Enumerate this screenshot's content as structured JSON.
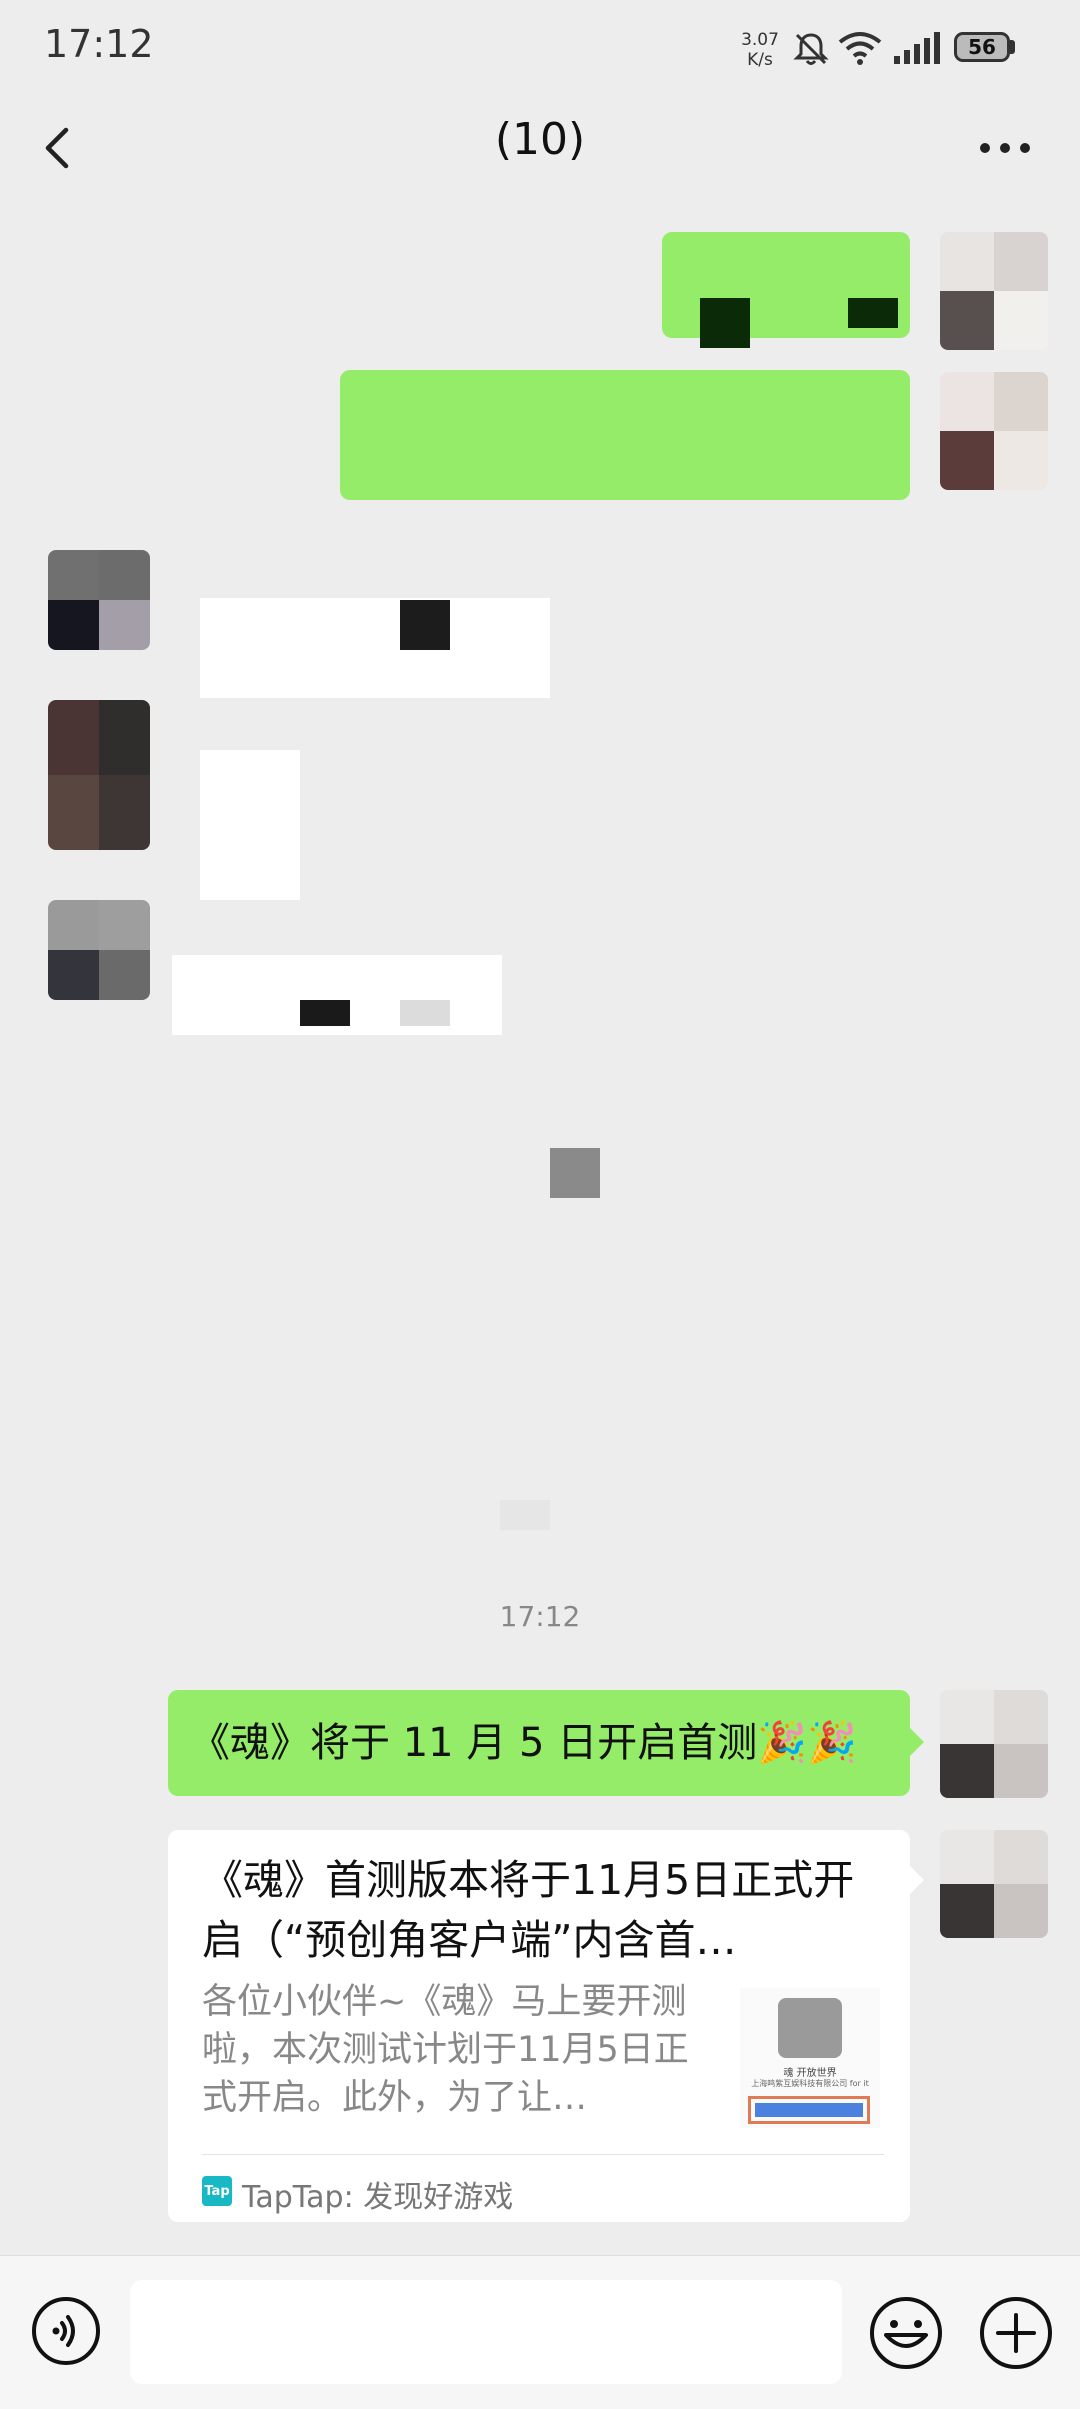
{
  "status_bar": {
    "time": "17:12",
    "net_speed_value": "3.07",
    "net_speed_unit": "K/s",
    "battery": "56",
    "icons": [
      "mute-bell-icon",
      "wifi-icon",
      "signal-icon",
      "battery-icon"
    ]
  },
  "header": {
    "title": "(10)",
    "back_icon": "chevron-left-icon",
    "more_icon": "more-dots-icon"
  },
  "chat": {
    "timestamp": "17:12",
    "messages": [
      {
        "type": "text",
        "sender": "self",
        "text": "《魂》将于 11 月 5 日开启首测🎉🎉"
      },
      {
        "type": "link",
        "sender": "self",
        "title": "《魂》首测版本将于11月5日正式开启（“预创角客户端”内含首…",
        "description": "各位小伙伴~《魂》马上要开测啦，本次测试计划于11月5日正式开启。此外，为了让…",
        "source": "TapTap: 发现好游戏",
        "source_icon": "Tap",
        "thumb_caption": "魂 开放世界",
        "thumb_company": "上海鸣紫互娱科技有限公司 for it"
      }
    ]
  },
  "input_bar": {
    "voice_icon": "voice-icon",
    "emoji_icon": "emoji-icon",
    "plus_icon": "plus-icon",
    "placeholder": ""
  },
  "colors": {
    "background": "#ededed",
    "self_bubble": "#95ec69",
    "other_bubble": "#ffffff",
    "accent_tap": "#18b9c5"
  }
}
